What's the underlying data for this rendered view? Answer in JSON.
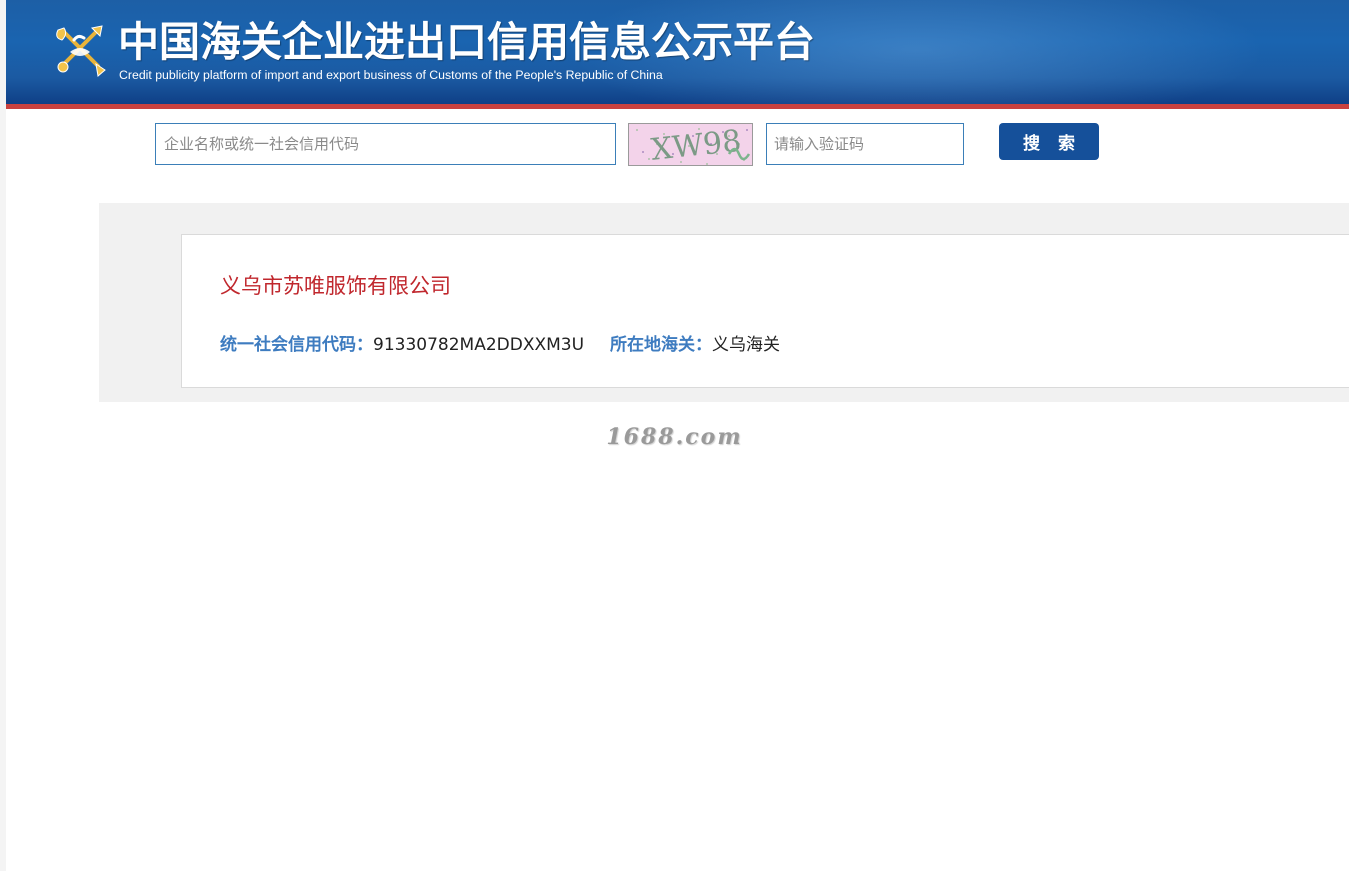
{
  "header": {
    "title": "中国海关企业进出口信用信息公示平台",
    "subtitle": "Credit publicity platform of import and export business of Customs of the People's Republic of China",
    "emblem_icon": "customs-emblem-icon"
  },
  "search": {
    "company_placeholder": "企业名称或统一社会信用代码",
    "company_value": "",
    "captcha_text": "XW98",
    "captcha_placeholder": "请输入验证码",
    "captcha_value": "",
    "button_label": "搜 索"
  },
  "result": {
    "company_name": "义乌市苏唯服饰有限公司",
    "credit_code_label": "统一社会信用代码：",
    "credit_code_value": "91330782MA2DDXXM3U",
    "customs_label": "所在地海关：",
    "customs_value": "义乌海关"
  },
  "watermark": "1688.com",
  "colors": {
    "header_blue": "#1b5aa2",
    "header_stripe": "#c9413f",
    "button_blue": "#15509a",
    "company_red": "#c0272d",
    "label_blue": "#3e7cc0",
    "input_border": "#3b7fb8"
  }
}
